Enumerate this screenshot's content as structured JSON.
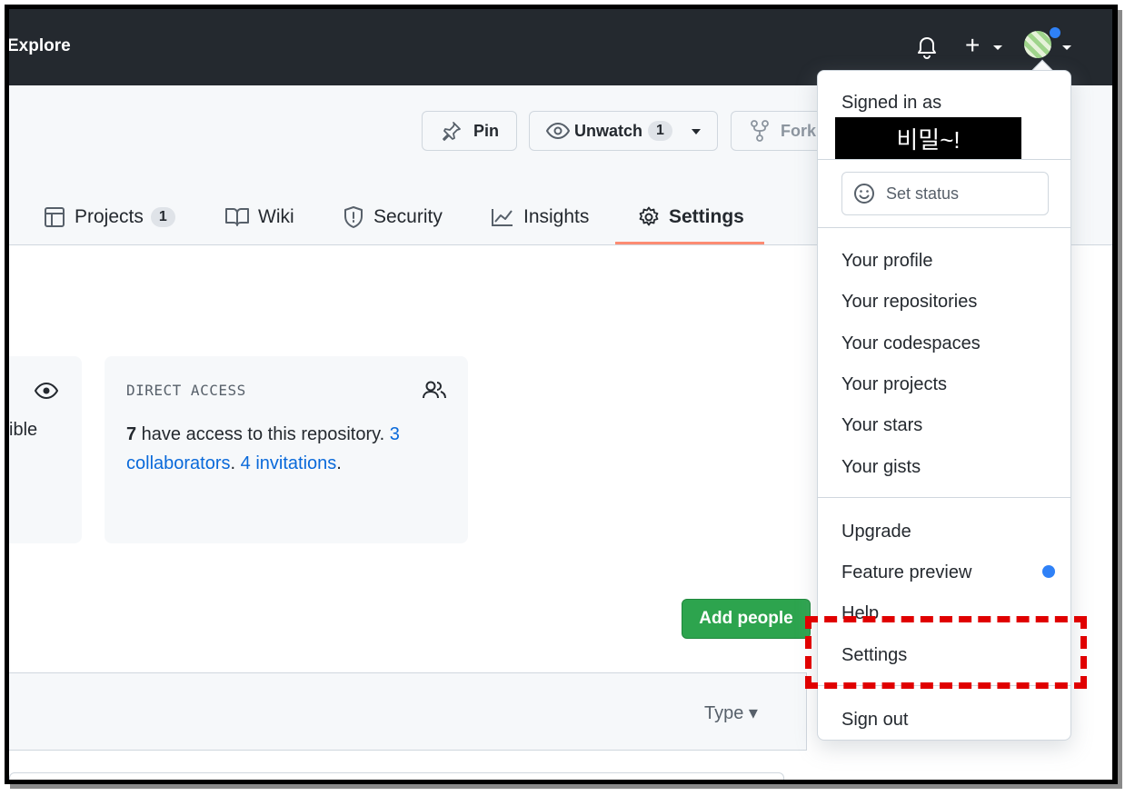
{
  "header": {
    "explore_label": "Explore",
    "plus_label": "+"
  },
  "repo": {
    "pin_label": "Pin",
    "unwatch_label": "Unwatch",
    "unwatch_count": "1",
    "fork_label": "Fork",
    "tabs": [
      {
        "label": "Projects",
        "count": "1"
      },
      {
        "label": "Wiki"
      },
      {
        "label": "Security"
      },
      {
        "label": "Insights"
      },
      {
        "label": "Settings",
        "active": true
      }
    ]
  },
  "cards": {
    "visibility_partial_text": "ible",
    "direct_access_title": "DIRECT ACCESS",
    "access_count": "7",
    "access_text": " have access to this repository. ",
    "collaborators_link": "3 collaborators",
    "period1": ". ",
    "invitations_link": "4 invitations",
    "period2": "."
  },
  "add_people_label": "Add people",
  "type_label": "Type ▾",
  "dropdown": {
    "signed_in_label": "Signed in as",
    "username": "비밀~!",
    "set_status_label": "Set status",
    "items_group1": [
      "Your profile",
      "Your repositories",
      "Your codespaces",
      "Your projects",
      "Your stars",
      "Your gists"
    ],
    "items_group2": [
      "Upgrade",
      "Feature preview",
      "Help",
      "Settings"
    ],
    "sign_out_label": "Sign out"
  },
  "colors": {
    "header_bg": "#24292f",
    "accent_underline": "#fd8c73",
    "primary_green": "#2da44e",
    "link_blue": "#0969da",
    "highlight_red": "#e00000"
  }
}
